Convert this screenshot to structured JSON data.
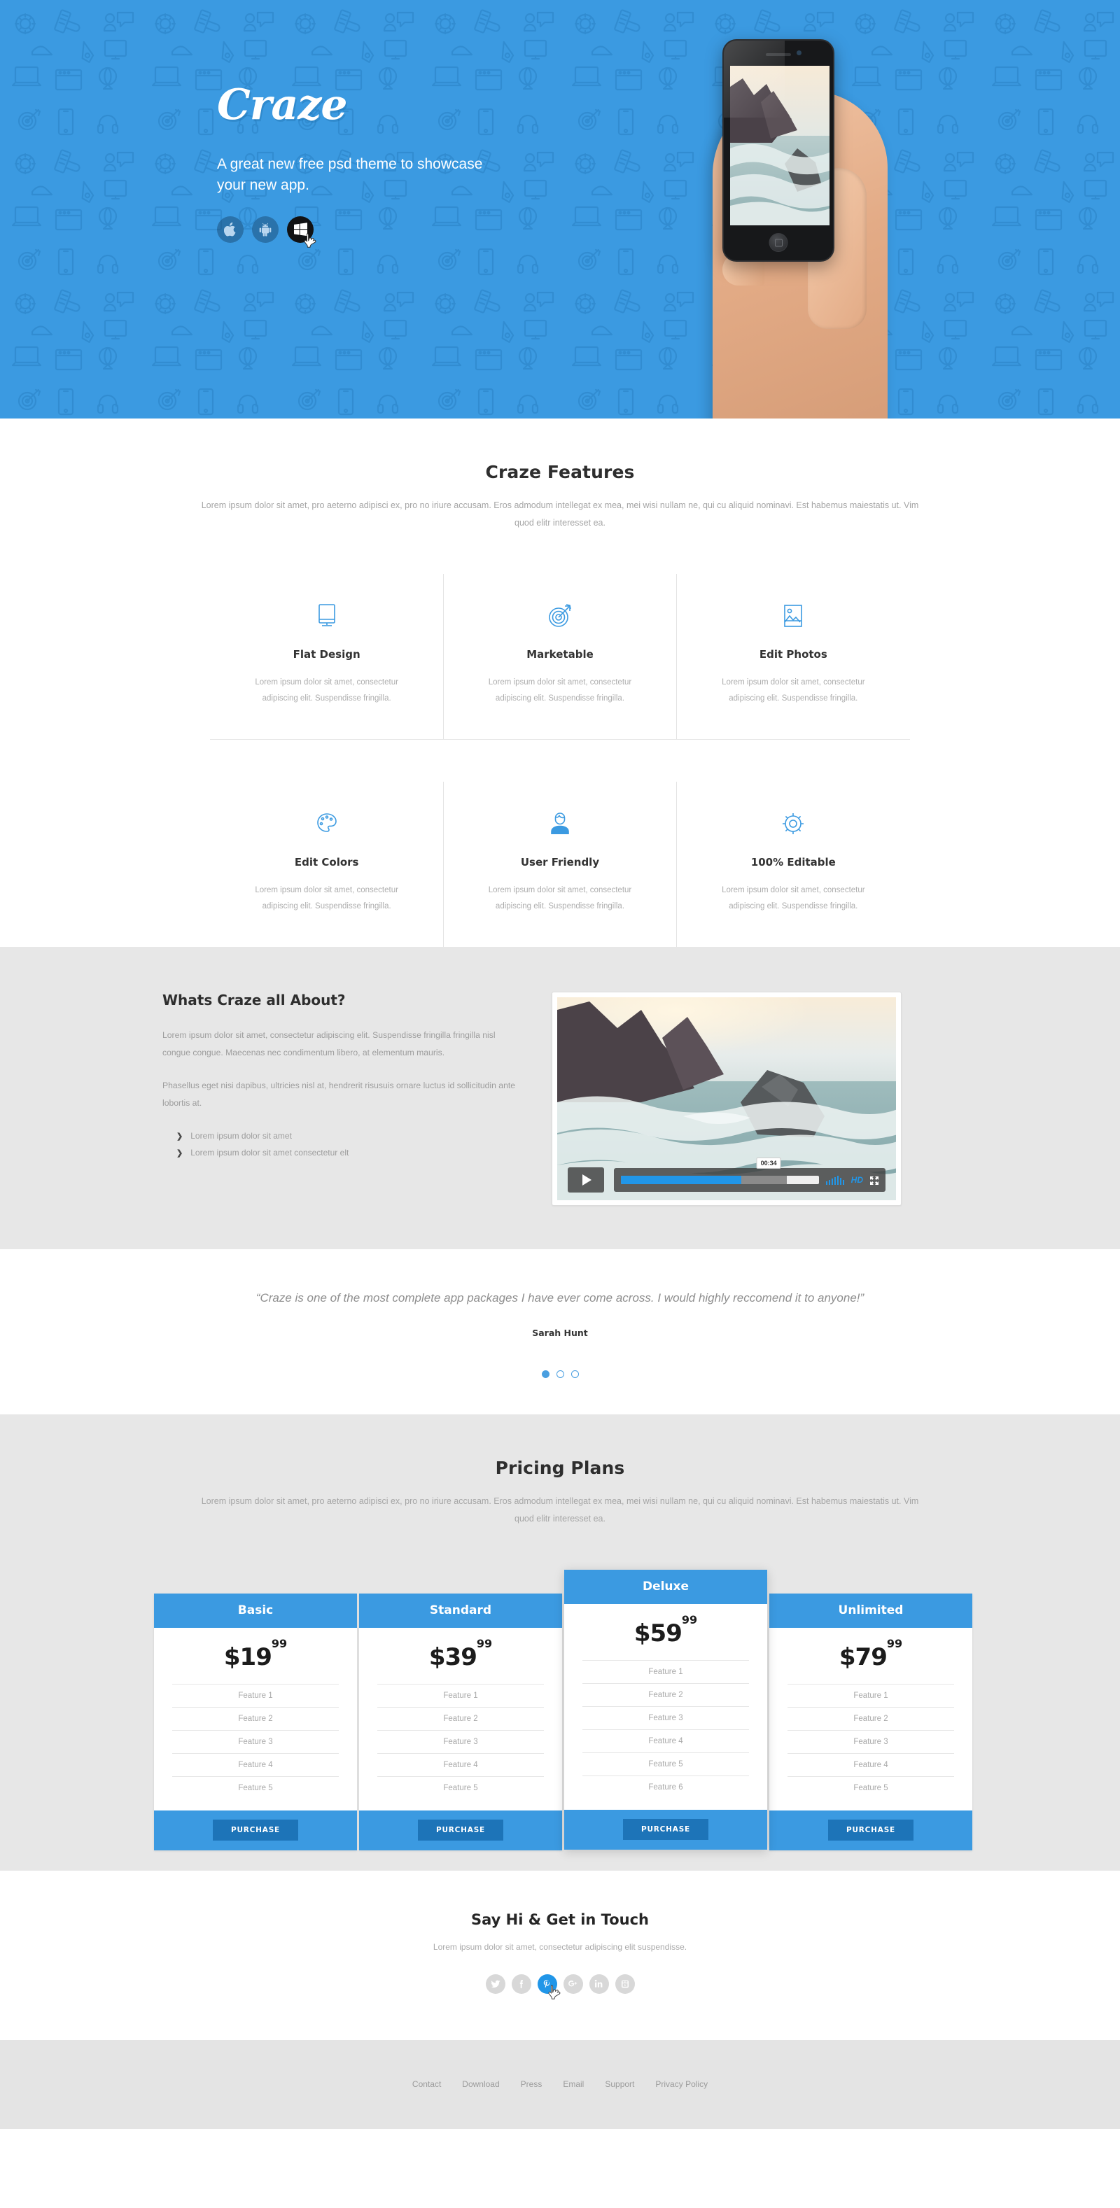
{
  "colors": {
    "brand_blue": "#3b9ae1",
    "accent_blue": "#2196e8",
    "dark_blue": "#1d74b8",
    "gray_band": "#e7e7e7",
    "footer_gray": "#e4e4e4",
    "muted_text": "#a8a8a8"
  },
  "hero": {
    "logo": "Craze",
    "tagline": "A great new free psd theme to showcase your new app.",
    "store_buttons": [
      {
        "name": "apple-store-button",
        "icon": "apple-icon",
        "active": false
      },
      {
        "name": "android-store-button",
        "icon": "android-icon",
        "active": false
      },
      {
        "name": "windows-store-button",
        "icon": "windows-icon",
        "active": true
      }
    ]
  },
  "features": {
    "title": "Craze Features",
    "subtitle": "Lorem ipsum dolor sit amet, pro aeterno adipisci ex, pro no iriure accusam. Eros admodum intellegat ex mea, mei wisi nullam ne, qui cu aliquid nominavi. Est habemus maiestatis ut. Vim quod elitr interesset ea.",
    "items": [
      {
        "icon": "monitor-icon",
        "title": "Flat Design",
        "text": "Lorem ipsum dolor sit amet, consectetur adipiscing elit. Suspendisse fringilla."
      },
      {
        "icon": "target-arrow-icon",
        "title": "Marketable",
        "text": "Lorem ipsum dolor sit amet, consectetur adipiscing elit. Suspendisse fringilla."
      },
      {
        "icon": "photo-icon",
        "title": "Edit Photos",
        "text": "Lorem ipsum dolor sit amet, consectetur adipiscing elit. Suspendisse fringilla."
      },
      {
        "icon": "palette-icon",
        "title": "Edit Colors",
        "text": "Lorem ipsum dolor sit amet, consectetur adipiscing elit. Suspendisse fringilla."
      },
      {
        "icon": "user-icon",
        "title": "User Friendly",
        "text": "Lorem ipsum dolor sit amet, consectetur adipiscing elit. Suspendisse fringilla."
      },
      {
        "icon": "gear-icon",
        "title": "100% Editable",
        "text": "Lorem ipsum dolor sit amet, consectetur adipiscing elit. Suspendisse fringilla."
      }
    ]
  },
  "about": {
    "heading": "Whats Craze all About?",
    "paragraph1": "Lorem ipsum dolor sit amet, consectetur adipiscing elit. Suspendisse fringilla fringilla nisl congue congue. Maecenas nec condimentum libero, at elementum mauris.",
    "paragraph2": "Phasellus eget nisi dapibus, ultricies nisl at, hendrerit risusuis ornare luctus id sollicitudin ante lobortis at.",
    "bullets": [
      "Lorem ipsum dolor sit amet",
      "Lorem ipsum dolor sit amet consectetur elt"
    ],
    "video": {
      "time": "00:34",
      "hd_label": "HD",
      "play_label": "Play",
      "progress_percent": 61,
      "buffered_percent": 84
    }
  },
  "testimonial": {
    "quote": "“Craze is one of the most complete app packages I have ever come across. I would highly reccomend it to anyone!”",
    "author": "Sarah Hunt",
    "dots": [
      true,
      false,
      false
    ]
  },
  "pricing": {
    "title": "Pricing Plans",
    "subtitle": "Lorem ipsum dolor sit amet, pro aeterno adipisci ex, pro no iriure accusam. Eros admodum intellegat ex mea, mei wisi nullam ne, qui cu aliquid nominavi. Est habemus maiestatis ut. Vim quod elitr interesset ea.",
    "purchase_label": "PURCHASE",
    "plans": [
      {
        "name": "Basic",
        "price_main": "$19",
        "price_cents": "99",
        "featured": false,
        "features": [
          "Feature 1",
          "Feature 2",
          "Feature 3",
          "Feature 4",
          "Feature 5"
        ]
      },
      {
        "name": "Standard",
        "price_main": "$39",
        "price_cents": "99",
        "featured": false,
        "features": [
          "Feature 1",
          "Feature 2",
          "Feature 3",
          "Feature 4",
          "Feature 5"
        ]
      },
      {
        "name": "Deluxe",
        "price_main": "$59",
        "price_cents": "99",
        "featured": true,
        "features": [
          "Feature 1",
          "Feature 2",
          "Feature 3",
          "Feature 4",
          "Feature 5",
          "Feature 6"
        ]
      },
      {
        "name": "Unlimited",
        "price_main": "$79",
        "price_cents": "99",
        "featured": false,
        "features": [
          "Feature 1",
          "Feature 2",
          "Feature 3",
          "Feature 4",
          "Feature 5"
        ]
      }
    ]
  },
  "contact": {
    "heading": "Say Hi & Get in Touch",
    "text": "Lorem ipsum dolor sit amet, consectetur adipiscing elit suspendisse.",
    "socials": [
      {
        "icon": "twitter-icon",
        "label": "Twitter",
        "active": false
      },
      {
        "icon": "facebook-icon",
        "label": "Facebook",
        "active": false
      },
      {
        "icon": "pinterest-icon",
        "label": "Pinterest",
        "active": true
      },
      {
        "icon": "google-plus-icon",
        "label": "Google Plus",
        "active": false
      },
      {
        "icon": "linkedin-icon",
        "label": "LinkedIn",
        "active": false
      },
      {
        "icon": "youtube-icon",
        "label": "YouTube",
        "active": false
      }
    ]
  },
  "footer": {
    "links": [
      "Contact",
      "Download",
      "Press",
      "Email",
      "Support",
      "Privacy Policy"
    ]
  }
}
